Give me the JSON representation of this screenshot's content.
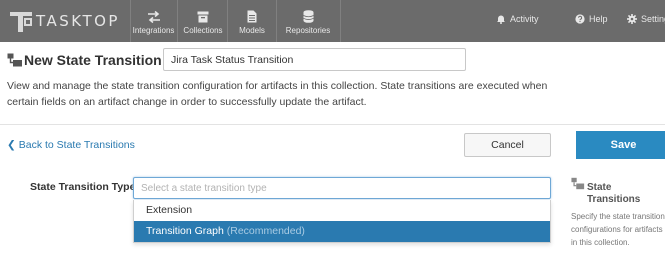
{
  "app": {
    "logo_text": "TASKTOP",
    "nav": [
      {
        "label": "Integrations",
        "icon": "arrows-icon"
      },
      {
        "label": "Collections",
        "icon": "archive-icon"
      },
      {
        "label": "Models",
        "icon": "document-icon"
      },
      {
        "label": "Repositories",
        "icon": "database-icon"
      }
    ],
    "right": {
      "activity": "Activity",
      "help": "Help",
      "settings": "Settings"
    }
  },
  "page": {
    "title": "New State Transition",
    "name_value": "Jira Task Status Transition",
    "description": "View and manage the state transition configuration for artifacts in this collection. State transitions are executed when certain fields on an artifact change in order to successfully update the artifact."
  },
  "actions": {
    "back_label": "Back to State Transitions",
    "cancel_label": "Cancel",
    "save_label": "Save"
  },
  "form": {
    "type_label": "State Transition Type",
    "type_placeholder": "Select a state transition type",
    "options": [
      {
        "label": "Extension",
        "note": ""
      },
      {
        "label": "Transition Graph",
        "note": "(Recommended)"
      }
    ]
  },
  "help": {
    "title": "State Transitions",
    "text": "Specify the state transition configurations for artifacts in this collection."
  },
  "colors": {
    "topbar": "#6b6b6b",
    "accent": "#2a8ac1",
    "link": "#2a7ab0",
    "highlight": "#2a7ab0"
  }
}
